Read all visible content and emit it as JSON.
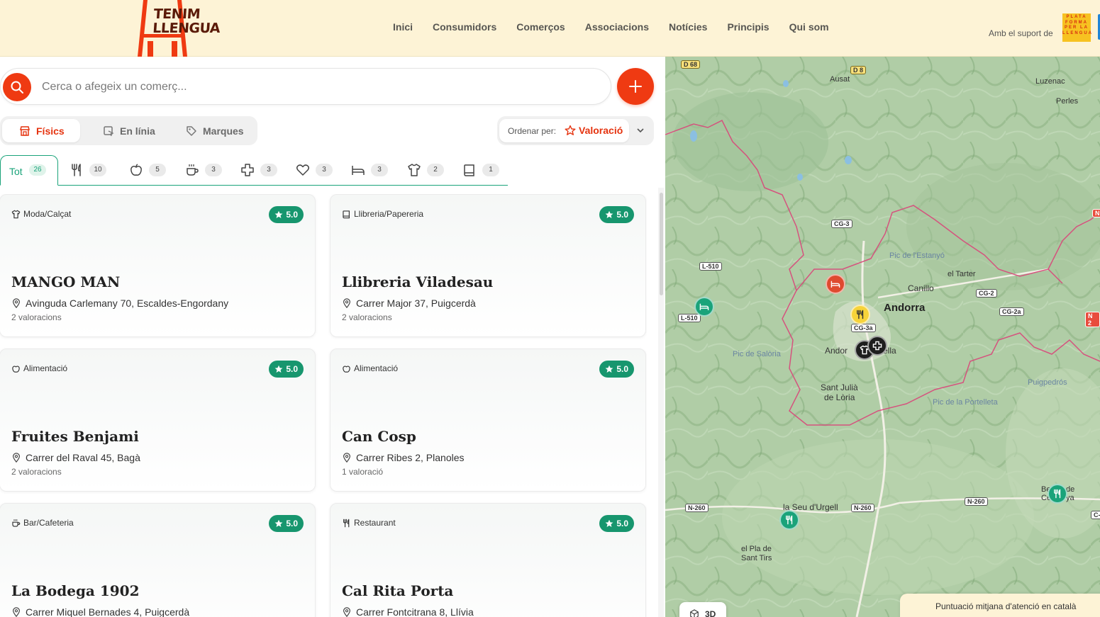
{
  "header": {
    "logo_line1": "TENIM",
    "logo_line2": "LLENGUA",
    "nav": [
      "Inici",
      "Consumidors",
      "Comerços",
      "Associacions",
      "Notícies",
      "Principis",
      "Qui som"
    ],
    "support_text": "Amb el suport de",
    "support_logo_lines": [
      "PLATA",
      "FORMA",
      "PER LA",
      "LLENGUA"
    ]
  },
  "search": {
    "placeholder": "Cerca o afegeix un comerç..."
  },
  "type_tabs": [
    "Físics",
    "En línia",
    "Marques"
  ],
  "sort": {
    "label": "Ordenar per:",
    "value": "Valoració"
  },
  "categories": {
    "all_label": "Tot",
    "all_count": "26",
    "items": [
      {
        "icon": "utensils-icon",
        "count": "10"
      },
      {
        "icon": "apple-icon",
        "count": "5"
      },
      {
        "icon": "coffee-cup-icon",
        "count": "3"
      },
      {
        "icon": "medical-cross-icon",
        "count": "3"
      },
      {
        "icon": "heart-icon",
        "count": "3"
      },
      {
        "icon": "bed-icon",
        "count": "3"
      },
      {
        "icon": "tshirt-icon",
        "count": "2"
      },
      {
        "icon": "book-icon",
        "count": "1"
      }
    ]
  },
  "shops": [
    {
      "category": "Moda/Calçat",
      "icon": "tshirt-icon",
      "rating": "5.0",
      "name": "MANGO MAN",
      "address": "Avinguda Carlemany 70, Escaldes-Engordany",
      "reviews": "2 valoracions"
    },
    {
      "category": "Llibreria/Papereria",
      "icon": "book-icon",
      "rating": "5.0",
      "name": "Llibreria Viladesau",
      "address": "Carrer Major 37, Puigcerdà",
      "reviews": "2 valoracions"
    },
    {
      "category": "Alimentació",
      "icon": "apple-icon",
      "rating": "5.0",
      "name": "Fruites Benjami",
      "address": "Carrer del Raval 45, Bagà",
      "reviews": "2 valoracions"
    },
    {
      "category": "Alimentació",
      "icon": "apple-icon",
      "rating": "5.0",
      "name": "Can Cosp",
      "address": "Carrer Ribes 2, Planoles",
      "reviews": "1 valoració"
    },
    {
      "category": "Bar/Cafeteria",
      "icon": "coffee-cup-icon",
      "rating": "5.0",
      "name": "La Bodega 1902",
      "address": "Carrer Miquel Bernades 4, Puigcerdà",
      "reviews": ""
    },
    {
      "category": "Restaurant",
      "icon": "utensils-icon",
      "rating": "5.0",
      "name": "Cal Rita Porta",
      "address": "Carrer Fontcitrana 8, Llívia",
      "reviews": ""
    }
  ],
  "map": {
    "places": {
      "andorra": "Andorra",
      "andorra_vella_a": "Andor",
      "andorra_vella_b": "ella",
      "canillo": "Canillo",
      "el_tarter": "el Tarter",
      "ausat": "Ausat",
      "luzenac": "Luzenac",
      "perles": "Perles",
      "sant_julia_1": "Sant Julià",
      "sant_julia_2": "de Lòria",
      "la_seu": "la Seu d'Urgell",
      "el_pla_1": "el Pla de",
      "el_pla_2": "Sant Tirs",
      "puigpedros": "Puigpedrós",
      "bellver_1": "Be",
      "bellver_2": "de",
      "bellver_3": "Ce",
      "bellver_4": "ya"
    },
    "peaks": {
      "estanyo": "Pic de l'Estanyó",
      "saloria": "Pic de Salòria",
      "portelleta": "Pic de la Portelleta"
    },
    "roads": {
      "d68": "D 68",
      "d8": "D 8",
      "cg3": "CG-3",
      "l510a": "L-510",
      "l510b": "L-510",
      "cg2": "CG-2",
      "cg2a": "CG-2a",
      "cg3a": "CG-3a",
      "n260a": "N-260",
      "n260b": "N-260",
      "n260c": "N-260",
      "n2_edge": "N 2",
      "n_edge": "N",
      "c_edge": "C-"
    },
    "btn_3d": "3D",
    "legend_title": "Puntuació mitjana d'atenció en català"
  },
  "colors": {
    "accent": "#ef3a12",
    "rating_green": "#17966e",
    "header_bg": "#fdf3d6",
    "map_border": "#d9467a"
  }
}
